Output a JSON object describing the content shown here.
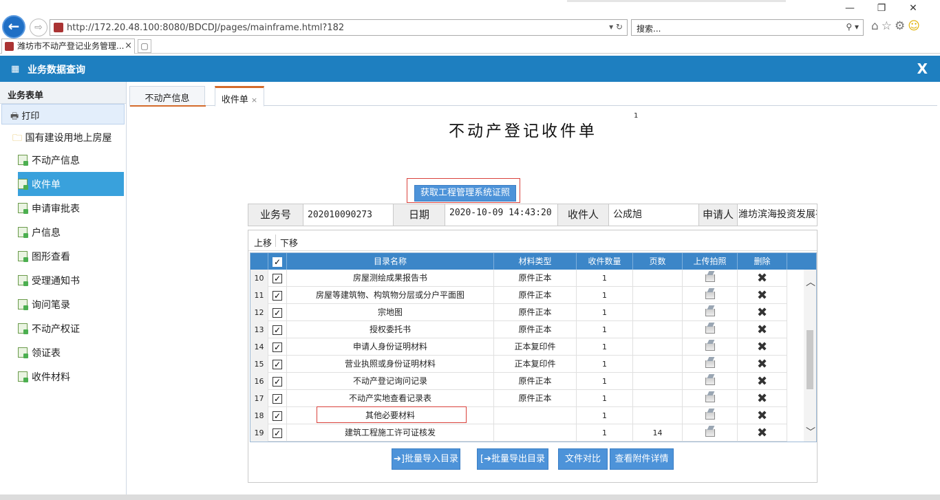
{
  "browser": {
    "url": "http://172.20.48.100:8080/BDCDJ/pages/mainframe.html?182",
    "search_placeholder": "搜索...",
    "tab_title": "潍坊市不动产登记业务管理...",
    "tab_close": "×"
  },
  "app": {
    "title": "业务数据查询",
    "close": "X"
  },
  "sidebar": {
    "heading": "业务表单",
    "print": "打印",
    "folder": "国有建设用地上房屋",
    "items": [
      {
        "label": "不动产信息"
      },
      {
        "label": "收件单"
      },
      {
        "label": "申请审批表"
      },
      {
        "label": "户信息"
      },
      {
        "label": "图形查看"
      },
      {
        "label": "受理通知书"
      },
      {
        "label": "询问笔录"
      },
      {
        "label": "不动产权证"
      },
      {
        "label": "领证表"
      },
      {
        "label": "收件材料"
      }
    ]
  },
  "main": {
    "tabs": [
      {
        "label": "不动产信息"
      },
      {
        "label": "收件单",
        "close": "×"
      }
    ],
    "doc_title": "不动产登记收件单",
    "page_num": "1",
    "fetch_button": "获取工程管理系统证照",
    "info": {
      "biz_no_label": "业务号",
      "biz_no": "202010090273",
      "date_label": "日期",
      "date": "2020-10-09 14:43:20",
      "receiver_label": "收件人",
      "receiver": "公成旭",
      "applicant_label": "申请人",
      "applicant": "潍坊滨海投资发展有"
    },
    "grid": {
      "move_up": "上移",
      "move_down": "下移",
      "columns": [
        "",
        "目录名称",
        "材料类型",
        "收件数量",
        "页数",
        "上传拍照",
        "删除"
      ],
      "rows": [
        {
          "no": "10",
          "name": "房屋测绘成果报告书",
          "type": "原件正本",
          "qty": "1",
          "pages": ""
        },
        {
          "no": "11",
          "name": "房屋等建筑物、构筑物分层或分户平面图",
          "type": "原件正本",
          "qty": "1",
          "pages": ""
        },
        {
          "no": "12",
          "name": "宗地图",
          "type": "原件正本",
          "qty": "1",
          "pages": ""
        },
        {
          "no": "13",
          "name": "授权委托书",
          "type": "原件正本",
          "qty": "1",
          "pages": ""
        },
        {
          "no": "14",
          "name": "申请人身份证明材料",
          "type": "正本复印件",
          "qty": "1",
          "pages": ""
        },
        {
          "no": "15",
          "name": "营业执照或身份证明材料",
          "type": "正本复印件",
          "qty": "1",
          "pages": ""
        },
        {
          "no": "16",
          "name": "不动产登记询问记录",
          "type": "原件正本",
          "qty": "1",
          "pages": ""
        },
        {
          "no": "17",
          "name": "不动产实地查看记录表",
          "type": "原件正本",
          "qty": "1",
          "pages": ""
        },
        {
          "no": "18",
          "name": "其他必要材料",
          "type": "",
          "qty": "1",
          "pages": ""
        },
        {
          "no": "19",
          "name": "建筑工程施工许可证核发",
          "type": "",
          "qty": "1",
          "pages": "14"
        }
      ]
    },
    "buttons": {
      "import": "➔]批量导入目录",
      "export": "[➔批量导出目录",
      "compare": "文件对比",
      "details": "查看附件详情"
    }
  }
}
